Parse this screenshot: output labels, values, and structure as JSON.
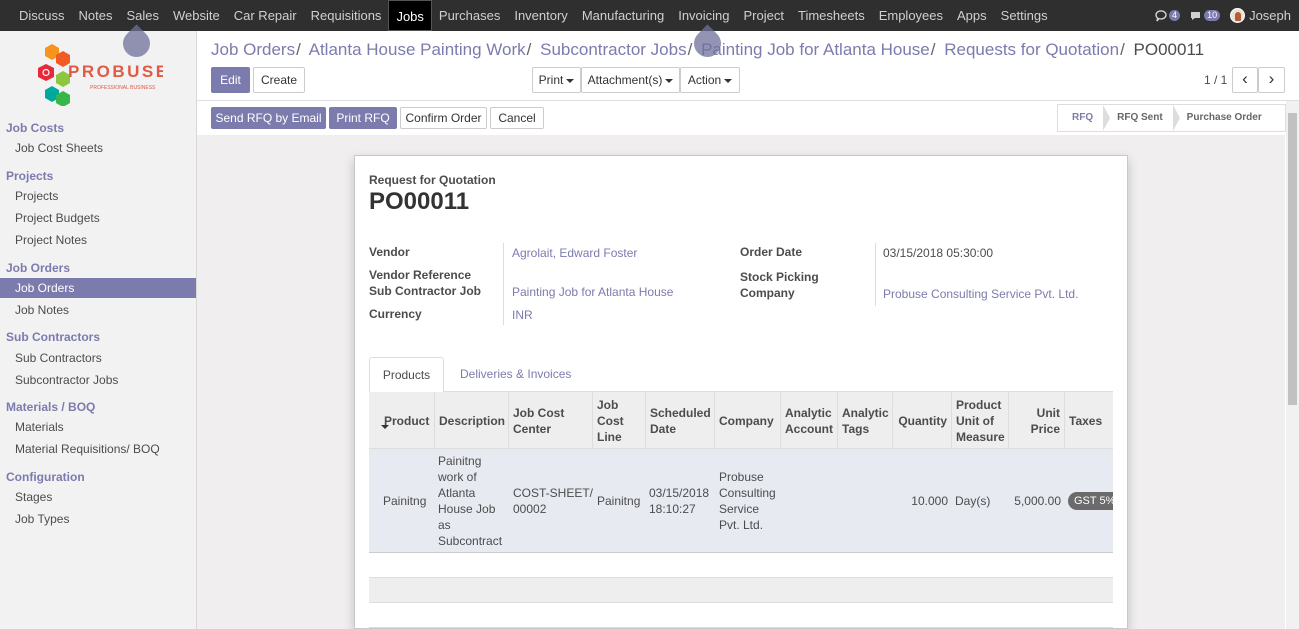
{
  "topnav": {
    "items": [
      "Discuss",
      "Notes",
      "Sales",
      "Website",
      "Car Repair",
      "Requisitions",
      "Jobs",
      "Purchases",
      "Inventory",
      "Manufacturing",
      "Invoicing",
      "Project",
      "Timesheets",
      "Employees",
      "Apps",
      "Settings"
    ],
    "active_index": 6,
    "messages_count": "4",
    "activity_count": "10",
    "user": "Joseph"
  },
  "logo": {
    "brand": "PROBUSE",
    "tagline": "PROFESSIONAL BUSINESS"
  },
  "sidebar": {
    "sections": [
      {
        "title": "Job Costs",
        "items": [
          "Job Cost Sheets"
        ]
      },
      {
        "title": "Projects",
        "items": [
          "Projects",
          "Project Budgets",
          "Project Notes"
        ]
      },
      {
        "title": "Job Orders",
        "items": [
          "Job Orders",
          "Job Notes"
        ]
      },
      {
        "title": "Sub Contractors",
        "items": [
          "Sub Contractors",
          "Subcontractor Jobs"
        ]
      },
      {
        "title": "Materials / BOQ",
        "items": [
          "Materials",
          "Material Requisitions/ BOQ"
        ]
      },
      {
        "title": "Configuration",
        "items": [
          "Stages",
          "Job Types"
        ]
      }
    ],
    "active_item": "Job Orders"
  },
  "breadcrumb": {
    "items": [
      "Job Orders",
      "Atlanta House Painting Work",
      "Subcontractor Jobs",
      "Painting Job for Atlanta House",
      "Requests for Quotation"
    ],
    "current": "PO00011"
  },
  "buttons": {
    "edit": "Edit",
    "create": "Create",
    "print": "Print",
    "attachments": "Attachment(s)",
    "action": "Action",
    "send_rfq": "Send RFQ by Email",
    "print_rfq": "Print RFQ",
    "confirm": "Confirm Order",
    "cancel": "Cancel"
  },
  "pager": {
    "text": "1 / 1",
    "prev": "‹",
    "next": "›"
  },
  "status": {
    "stages": [
      "RFQ",
      "RFQ Sent",
      "Purchase Order"
    ],
    "active": "RFQ"
  },
  "form": {
    "doc_type": "Request for Quotation",
    "name": "PO00011",
    "labels": {
      "vendor": "Vendor",
      "vendor_ref": "Vendor Reference",
      "sub_job": "Sub Contractor Job",
      "currency": "Currency",
      "order_date": "Order Date",
      "stock_picking": "Stock Picking",
      "company": "Company"
    },
    "values": {
      "vendor": "Agrolait, Edward Foster",
      "sub_job": "Painting Job for Atlanta House",
      "currency": "INR",
      "order_date": "03/15/2018 05:30:00",
      "company": "Probuse Consulting Service Pvt. Ltd."
    }
  },
  "tabs": [
    "Products",
    "Deliveries & Invoices"
  ],
  "table": {
    "headers": {
      "product": "Product",
      "description": "Description",
      "job_cost_center": "Job Cost Center",
      "job_cost_line": "Job Cost Line",
      "scheduled_date": "Scheduled Date",
      "company": "Company",
      "analytic_account": "Analytic Account",
      "analytic_tags": "Analytic Tags",
      "quantity": "Quantity",
      "uom": "Product Unit of Measure",
      "unit_price": "Unit Price",
      "taxes": "Taxes"
    },
    "row": {
      "product": "Painitng",
      "description": "Painitng work of Atlanta House Job as Subcontract",
      "job_cost_center": "COST-SHEET/00002",
      "job_cost_line": "Painitng",
      "scheduled_date": "03/15/2018 18:10:27",
      "company": "Probuse Consulting Service Pvt. Ltd.",
      "quantity": "10.000",
      "uom": "Day(s)",
      "unit_price": "5,000.00",
      "taxes": "GST 5%"
    }
  },
  "colors": {
    "accent": "#7c7bad",
    "topbar": "#2f2f2f"
  }
}
